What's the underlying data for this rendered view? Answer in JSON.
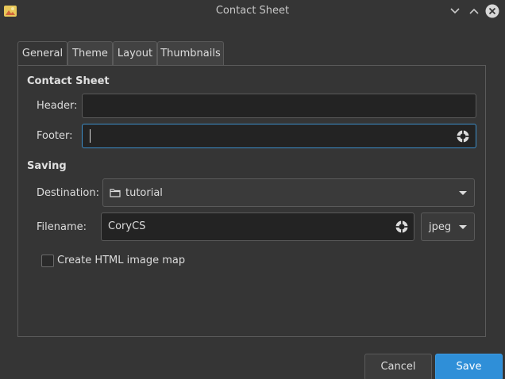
{
  "window": {
    "title": "Contact Sheet",
    "accent_color": "#2f8fd8"
  },
  "tabs": [
    {
      "label": "General",
      "active": true
    },
    {
      "label": "Theme",
      "active": false
    },
    {
      "label": "Layout",
      "active": false
    },
    {
      "label": "Thumbnails",
      "active": false
    }
  ],
  "contact_sheet": {
    "section_title": "Contact Sheet",
    "header_label": "Header:",
    "header_value": "",
    "footer_label": "Footer:",
    "footer_value": ""
  },
  "saving": {
    "section_title": "Saving",
    "destination_label": "Destination:",
    "destination_value": "tutorial",
    "filename_label": "Filename:",
    "filename_value": "CoryCS",
    "format_value": "jpeg",
    "html_map_label": "Create HTML image map",
    "html_map_checked": false
  },
  "buttons": {
    "cancel": "Cancel",
    "save": "Save"
  },
  "icons": {
    "app": "contact-sheet-app-icon",
    "minimize": "chevron-down-icon",
    "maximize": "chevron-up-icon",
    "close": "close-icon",
    "clear": "clear-field-icon",
    "folder": "folder-icon",
    "dropdown": "dropdown-arrow-icon"
  }
}
